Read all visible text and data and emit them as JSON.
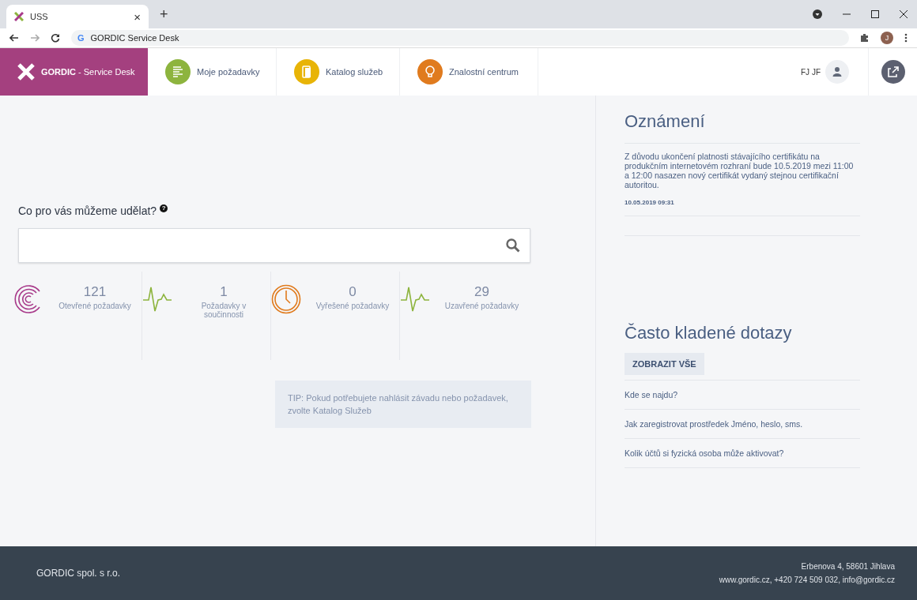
{
  "browser": {
    "tab_title": "USS",
    "tab_close": "×",
    "new_tab": "+",
    "url": "GORDIC Service Desk",
    "site_icon": "G",
    "profile_initial": "J"
  },
  "header": {
    "brand": "**GORDIC** - Service Desk",
    "nav": [
      {
        "label": "Moje požadavky",
        "kind": "list",
        "color": "#8db43e"
      },
      {
        "label": "Katalog služeb",
        "kind": "catalog",
        "color": "#e8b407"
      },
      {
        "label": "Znalostní centrum",
        "kind": "bulb",
        "color": "#e07b1e"
      }
    ],
    "user": "FJ JF"
  },
  "search": {
    "label": "Co pro vás můžeme udělat?",
    "help": "?"
  },
  "stats": [
    {
      "value": "121",
      "label": "Otevřené požadavky",
      "kind": "circles",
      "color": "#a83a8a"
    },
    {
      "value": "1",
      "label": "Požadavky v součinnosti",
      "kind": "pulse",
      "color": "#8db43e"
    },
    {
      "value": "0",
      "label": "Vyřešené požadavky",
      "kind": "clock",
      "color": "#e07b1e"
    },
    {
      "value": "29",
      "label": "Uzavřené požadavky",
      "kind": "pulse",
      "color": "#8db43e"
    }
  ],
  "tip": "TIP: Pokud potřebujete nahlásit závadu nebo požadavek, zvolte Katalog Služeb",
  "announcements": {
    "title": "Oznámení",
    "items": [
      {
        "text": "Z důvodu ukončení platnosti stávajícího certifikátu na produkčním internetovém rozhraní bude 10.5.2019 mezi 11:00 a 12:00 nasazen nový certifikát vydaný stejnou certifikační autoritou.",
        "date": "10.05.2019 09:31"
      }
    ]
  },
  "faq": {
    "title": "Často kladené dotazy",
    "button": "ZOBRAZIT VŠE",
    "questions": [
      "Kde se najdu?",
      "Jak zaregistrovat prostředek Jméno, heslo, sms.",
      "Kolik účtů si fyzická osoba může aktivovat?"
    ]
  },
  "footer": {
    "company": "GORDIC spol. s r.o.",
    "address": "Erbenova 4, 58601 Jihlava",
    "contacts": "www.gordic.cz, +420 724 509 032, info@gordic.cz"
  }
}
